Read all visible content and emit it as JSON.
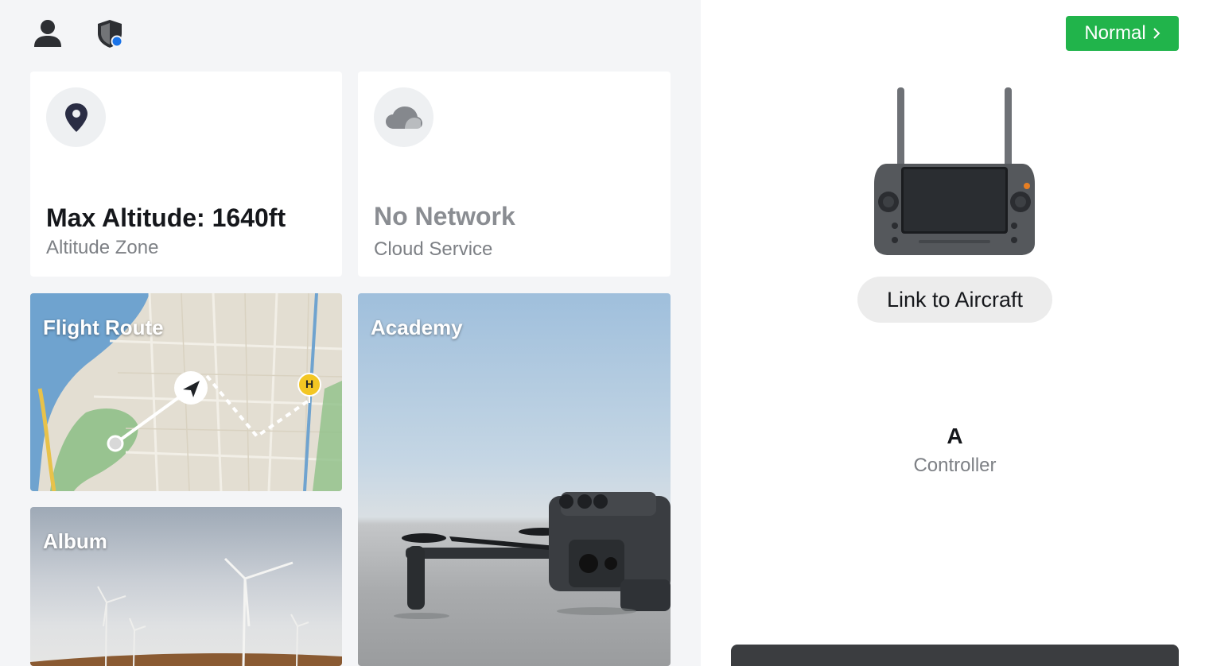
{
  "header": {
    "user_icon": "user-icon",
    "shield_icon": "shield-icon",
    "shield_badge_color": "#1a73e8"
  },
  "cards": {
    "altitude": {
      "icon": "location-pin-icon",
      "title": "Max Altitude: 1640ft",
      "subtitle": "Altitude Zone"
    },
    "network": {
      "icon": "cloud-icon",
      "title": "No Network",
      "subtitle": "Cloud Service"
    }
  },
  "tiles": {
    "flight_route": {
      "label": "Flight Route",
      "home_marker": "H"
    },
    "academy": {
      "label": "Academy"
    },
    "album": {
      "label": "Album"
    }
  },
  "status": {
    "mode_label": "Normal",
    "mode_color": "#21b44b",
    "link_button": "Link to Aircraft",
    "controller_letter": "A",
    "controller_label": "Controller"
  }
}
